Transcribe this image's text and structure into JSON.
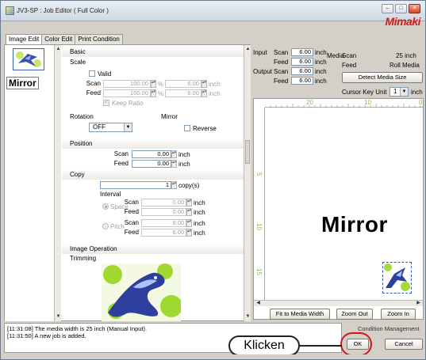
{
  "window": {
    "title": "JV3-SP : Job Editor ( Full Color )",
    "logo": "Mimaki",
    "min": "–",
    "max": "□",
    "close": "✕"
  },
  "tabs": [
    {
      "label": "Image Edit",
      "active": true
    },
    {
      "label": "Color Edit",
      "active": false
    },
    {
      "label": "Print Condition",
      "active": false
    }
  ],
  "thumbnail": {
    "label": "Mirror"
  },
  "settings": {
    "basic": "Basic",
    "scale": {
      "title": "Scale",
      "valid": "Valid",
      "scan_label": "Scan",
      "scan_pct": "100.00",
      "scan_inch": "6.00",
      "feed_label": "Feed",
      "feed_pct": "100.00",
      "feed_inch": "6.00",
      "pct_unit": "%",
      "inch_unit": "inch",
      "keep_ratio": "Keep Ratio"
    },
    "rotation": {
      "title": "Rotation",
      "value": "OFF"
    },
    "mirror": {
      "title": "Mirror",
      "reverse": "Reverse"
    },
    "position": {
      "title": "Position",
      "scan_label": "Scan",
      "scan_value": "0.00",
      "feed_label": "Feed",
      "feed_value": "0.00",
      "unit": "inch"
    },
    "copy": {
      "title": "Copy",
      "count": "1",
      "count_unit": "copy(s)",
      "interval": "Interval",
      "space": "Space",
      "pitch": "Pitch",
      "space_scan": "0.00",
      "space_feed": "0.00",
      "pitch_scan": "6.00",
      "pitch_feed": "6.00",
      "scan_label": "Scan",
      "feed_label": "Feed",
      "unit": "inch"
    },
    "image_operation": "Image Operation",
    "trimming": "Trimming"
  },
  "info": {
    "input_label": "Input",
    "input_scan_label": "Scan",
    "input_scan": "6.00",
    "input_feed_label": "Feed",
    "input_feed": "6.00",
    "output_label": "Output",
    "output_scan_label": "Scan",
    "output_scan": "6.00",
    "output_feed_label": "Feed",
    "output_feed": "6.00",
    "unit": "inch",
    "media_label": "Media",
    "media_scan_label": "Scan",
    "media_scan": "25 inch",
    "media_feed_label": "Feed",
    "media_feed": "Roll Media",
    "detect_button": "Detect Media Size",
    "cursor_key_label": "Cursor Key Unit",
    "cursor_key_value": "1",
    "cursor_key_unit": "inch"
  },
  "ruler": {
    "h20": "20",
    "h10": "10",
    "h0": "0",
    "v5": "5",
    "v10": "10",
    "v15": "15",
    "v20": "20"
  },
  "preview": {
    "text": "Mirror"
  },
  "preview_buttons": {
    "fit": "Fit to Media Width",
    "zoom_out": "Zoom Out",
    "zoom_in": "Zoom In"
  },
  "log": [
    "[11:31:08] The media width is 25 inch (Manual Input).",
    "[11:31:50] A new job is added."
  ],
  "condition_management": "Condition Management",
  "ok_button": "OK",
  "cancel_button": "Cancel",
  "callout": "Klicken",
  "colors": {
    "accent_red": "#d8131b",
    "logo_red": "#d11d1d",
    "panel_bg": "#d4d0c8"
  }
}
